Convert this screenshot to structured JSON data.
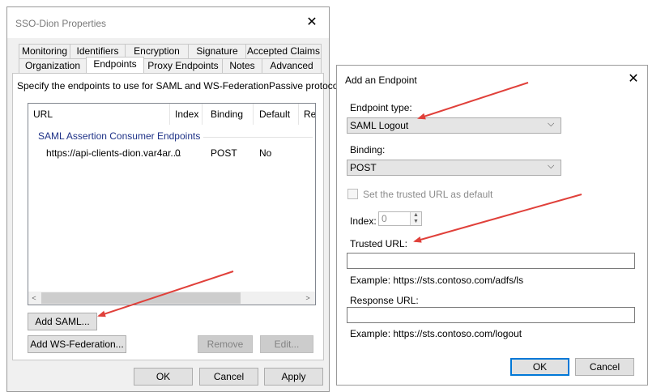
{
  "props_window": {
    "title": "SSO-Dion Properties",
    "close_glyph": "✕",
    "tabs_row1": [
      "Monitoring",
      "Identifiers",
      "Encryption",
      "Signature",
      "Accepted Claims"
    ],
    "tabs_row2": [
      "Organization",
      "Endpoints",
      "Proxy Endpoints",
      "Notes",
      "Advanced"
    ],
    "description": "Specify the endpoints to use for SAML and WS-FederationPassive protocols.",
    "columns": [
      "URL",
      "Index",
      "Binding",
      "Default",
      "Re"
    ],
    "group_header": "SAML Assertion Consumer Endpoints",
    "rows": [
      {
        "url": "https://api-clients-dion.var4ar....",
        "index": "0",
        "binding": "POST",
        "default": "No"
      }
    ],
    "scroll_left": "<",
    "scroll_right": ">",
    "add_saml_label": "Add SAML...",
    "add_wsfed_label": "Add WS-Federation...",
    "remove_label": "Remove",
    "edit_label": "Edit...",
    "ok_label": "OK",
    "cancel_label": "Cancel",
    "apply_label": "Apply"
  },
  "endpoint_dialog": {
    "title": "Add an Endpoint",
    "close_glyph": "✕",
    "endpoint_type_label": "Endpoint type:",
    "endpoint_type_value": "SAML Logout",
    "binding_label": "Binding:",
    "binding_value": "POST",
    "trusted_default_label": "Set the trusted URL as default",
    "index_label": "Index:",
    "index_value": "0",
    "trusted_url_label": "Trusted URL:",
    "trusted_url_value": "",
    "trusted_example": "Example: https://sts.contoso.com/adfs/ls",
    "response_url_label": "Response URL:",
    "response_url_value": "",
    "response_example": "Example: https://sts.contoso.com/logout",
    "ok_label": "OK",
    "cancel_label": "Cancel",
    "chevron": "⌵"
  },
  "colors": {
    "annotation_arrow": "#e0403a",
    "group_header": "#1e3287",
    "default_button_border": "#0078d7"
  }
}
